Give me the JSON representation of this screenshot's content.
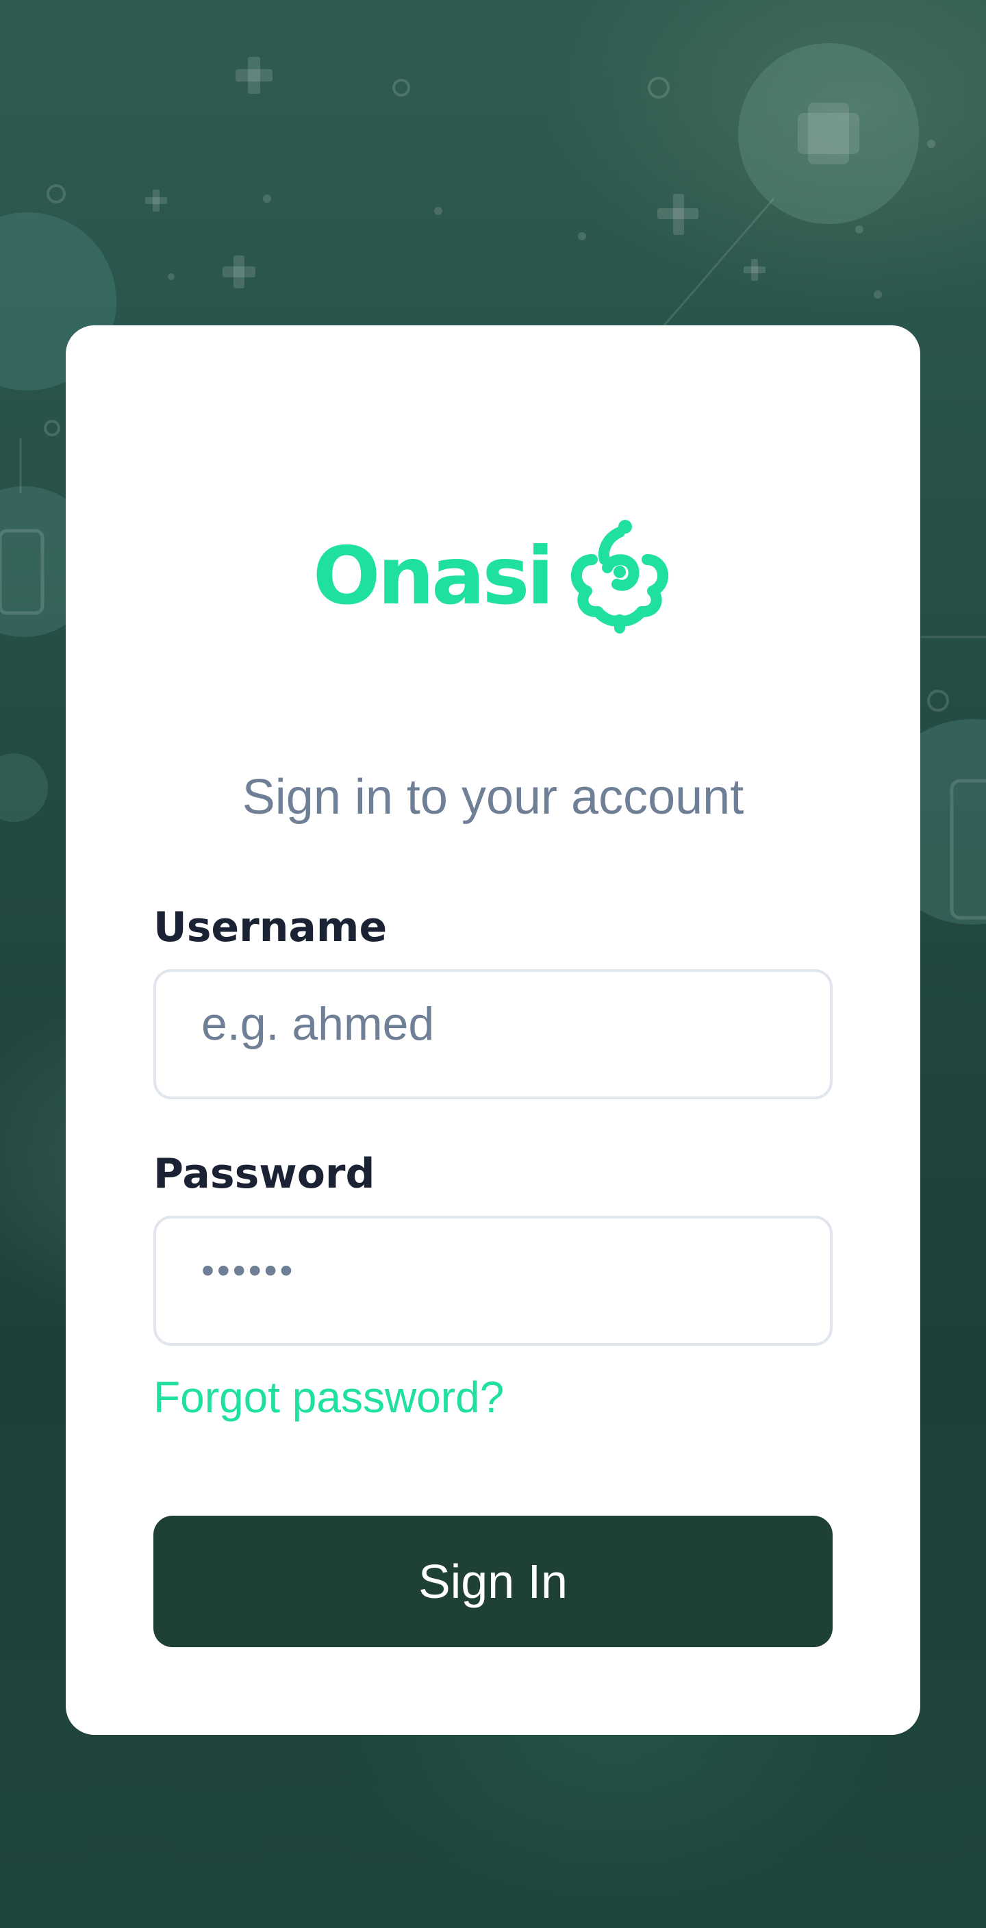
{
  "brand": {
    "name": "Onasi",
    "color": "#1fe0a0"
  },
  "login": {
    "title": "Sign in to your account",
    "username": {
      "label": "Username",
      "placeholder": "e.g. ahmed"
    },
    "password": {
      "label": "Password",
      "placeholder": "••••••"
    },
    "forgot_password": "Forgot password?",
    "submit_label": "Sign In"
  },
  "colors": {
    "primary_button": "#1e4036",
    "accent": "#1fe0a0",
    "muted_text": "#6f7f96",
    "label_text": "#1a2233"
  },
  "icons": {
    "logo_mark": "onasi-logo-icon"
  }
}
